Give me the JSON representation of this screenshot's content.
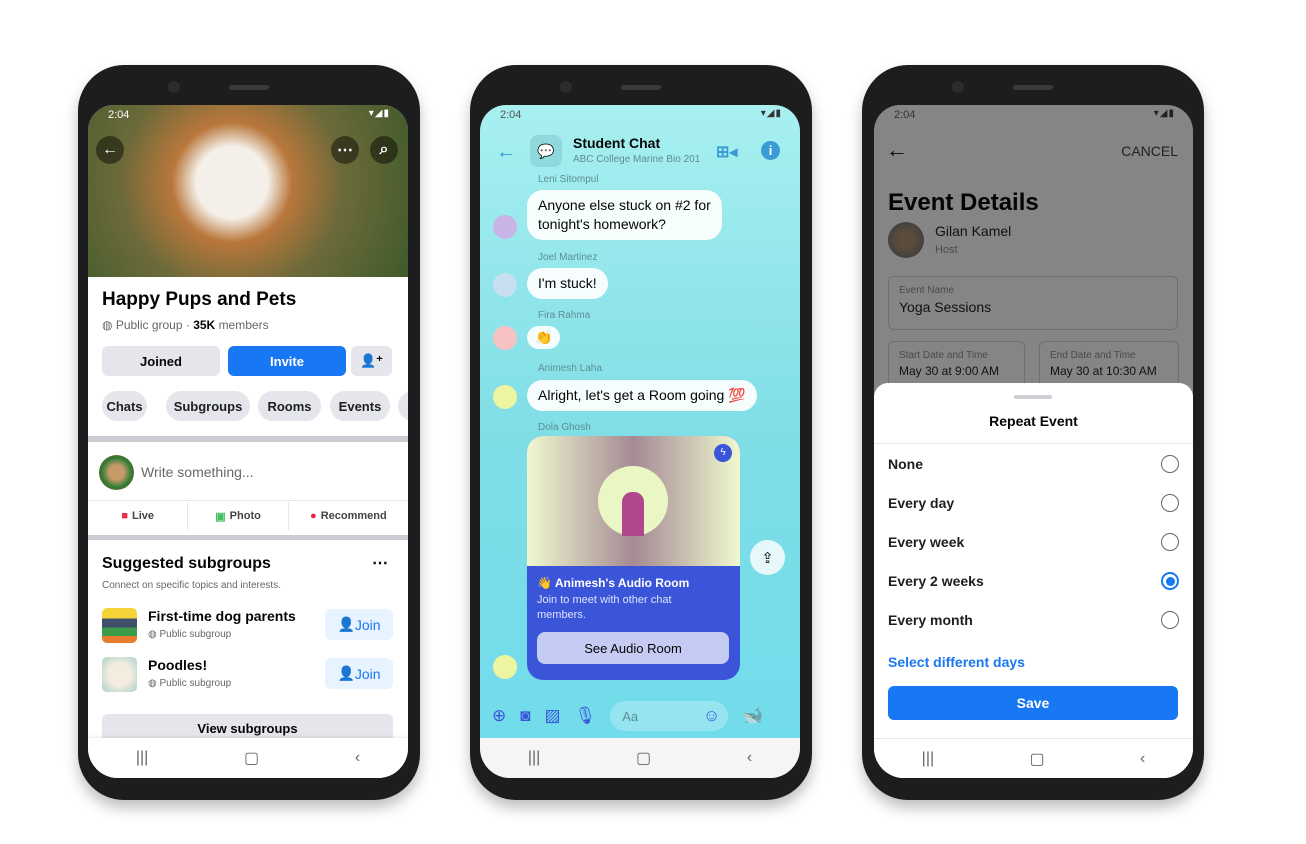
{
  "status_time": "2:04",
  "group": {
    "title": "Happy Pups and Pets",
    "privacy": "Public group",
    "members": "35K",
    "members_label": "members",
    "joined": "Joined",
    "invite": "Invite",
    "chips": [
      "Chats",
      "Subgroups",
      "Rooms",
      "Events"
    ],
    "composer_placeholder": "Write something...",
    "actions": [
      "Live",
      "Photo",
      "Recommend"
    ],
    "suggested_title": "Suggested subgroups",
    "suggested_sub": "Connect on specific topics and interests.",
    "subgroups": [
      {
        "name": "First-time dog parents",
        "type": "Public subgroup",
        "join": "Join"
      },
      {
        "name": "Poodles!",
        "type": "Public subgroup",
        "join": "Join"
      }
    ],
    "view_subgroups": "View subgroups",
    "accent": "#1877f2"
  },
  "chat": {
    "title": "Student Chat",
    "subtitle": "ABC College Marine Bio 201",
    "messages": [
      {
        "sender": "Leni Sitompul",
        "text": "Anyone else stuck on #2 for tonight's homework?"
      },
      {
        "sender": "Joel Martinez",
        "text": "I'm stuck!"
      },
      {
        "sender": "Fira Rahma",
        "text": "👏"
      },
      {
        "sender": "Animesh Laha",
        "text": "Alright, let's get a Room going 💯"
      },
      {
        "sender": "Dola Ghosh",
        "text": ""
      }
    ],
    "room_title": "👋 Animesh's Audio Room",
    "room_desc": "Join to meet with other chat members.",
    "room_button": "See Audio Room",
    "input_placeholder": "Aa",
    "room_color": "#3b55d9"
  },
  "event": {
    "cancel": "CANCEL",
    "title": "Event Details",
    "host_name": "Gilan Kamel",
    "host_role": "Host",
    "event_name_label": "Event Name",
    "event_name": "Yoga Sessions",
    "start_label": "Start Date and Time",
    "start": "May 30 at 9:00 AM",
    "end_label": "End Date and Time",
    "end": "May 30 at 10:30 AM",
    "sheet_title": "Repeat Event",
    "options": [
      "None",
      "Every day",
      "Every week",
      "Every 2 weeks",
      "Every month"
    ],
    "selected": "Every 2 weeks",
    "select_days": "Select different days",
    "save": "Save"
  }
}
